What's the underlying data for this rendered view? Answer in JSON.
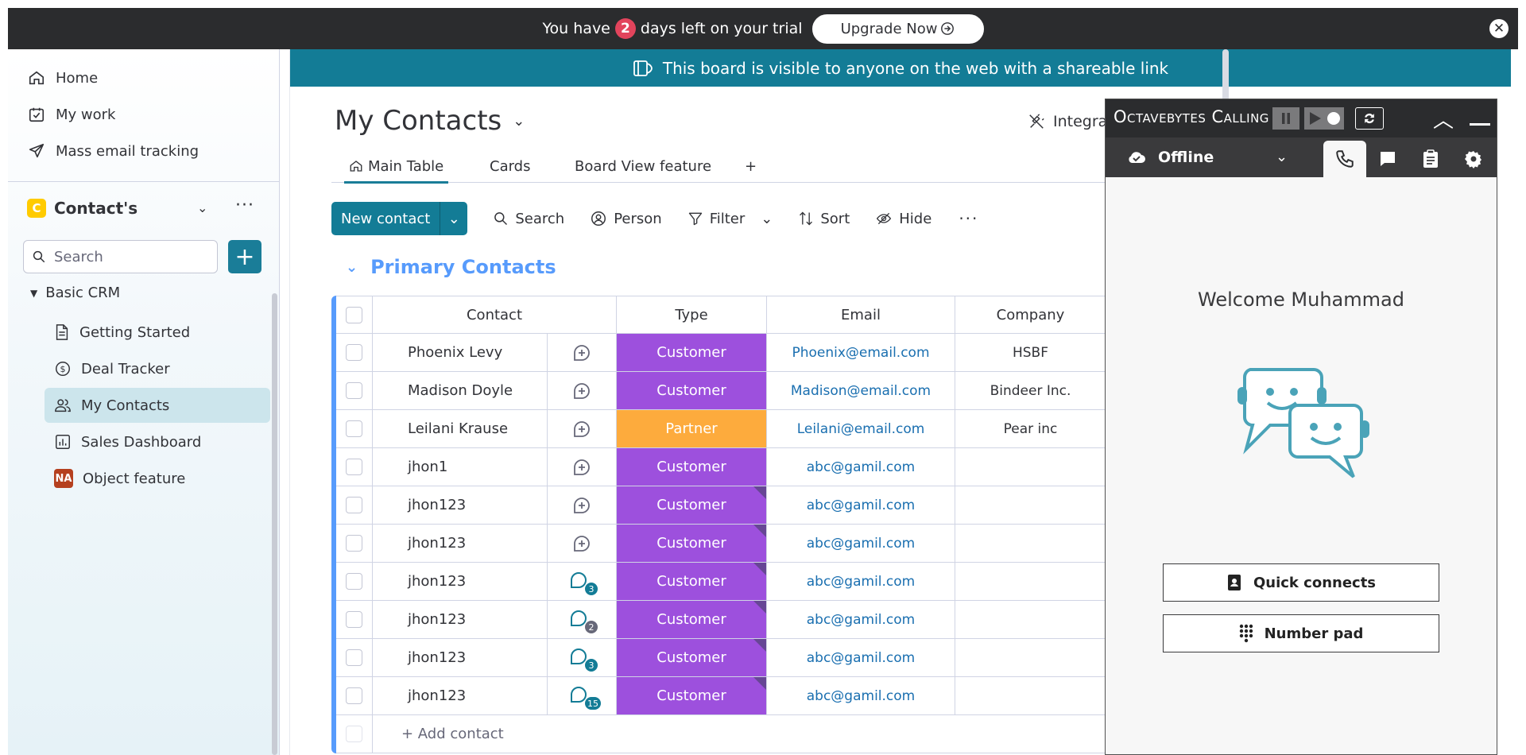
{
  "trial": {
    "prefix": "You have",
    "days": "2",
    "suffix": "days left on your trial",
    "upgrade_label": "Upgrade Now"
  },
  "sidebar": {
    "nav": [
      {
        "label": "Home",
        "icon": "home-icon"
      },
      {
        "label": "My work",
        "icon": "calendar-check-icon"
      },
      {
        "label": "Mass email tracking",
        "icon": "send-icon"
      }
    ],
    "workspace": {
      "badge": "C",
      "name": "Contact's"
    },
    "search_placeholder": "Search",
    "tree_root": "Basic CRM",
    "items": [
      {
        "label": "Getting Started",
        "icon": "document-icon"
      },
      {
        "label": "Deal Tracker",
        "icon": "dollar-icon"
      },
      {
        "label": "My Contacts",
        "icon": "people-icon",
        "active": true
      },
      {
        "label": "Sales Dashboard",
        "icon": "dashboard-icon"
      },
      {
        "label": "Object feature",
        "icon": "na-badge-icon",
        "badge": "NA"
      }
    ]
  },
  "banner": {
    "text": "This board is visible to anyone on the web with a shareable link"
  },
  "board": {
    "title": "My Contacts",
    "integrate": "Integrat",
    "tabs": [
      "Main Table",
      "Cards",
      "Board View feature",
      "+"
    ]
  },
  "toolbar": {
    "new_label": "New contact",
    "search": "Search",
    "person": "Person",
    "filter": "Filter",
    "sort": "Sort",
    "hide": "Hide",
    "more": "···"
  },
  "group": {
    "title": "Primary Contacts"
  },
  "table": {
    "columns": [
      "Contact",
      "Type",
      "Email",
      "Company"
    ],
    "rows": [
      {
        "name": "Phoenix Levy",
        "type": "Customer",
        "email": "Phoenix@email.com",
        "company": "HSBF",
        "updates": ""
      },
      {
        "name": "Madison Doyle",
        "type": "Customer",
        "email": "Madison@email.com",
        "company": "Bindeer Inc.",
        "updates": ""
      },
      {
        "name": "Leilani Krause",
        "type": "Partner",
        "email": "Leilani@email.com",
        "company": "Pear inc",
        "updates": ""
      },
      {
        "name": "jhon1",
        "type": "Customer",
        "email": "abc@gamil.com",
        "company": "",
        "updates": ""
      },
      {
        "name": "jhon123",
        "type": "Customer",
        "email": "abc@gamil.com",
        "company": "",
        "updates": ""
      },
      {
        "name": "jhon123",
        "type": "Customer",
        "email": "abc@gamil.com",
        "company": "",
        "updates": ""
      },
      {
        "name": "jhon123",
        "type": "Customer",
        "email": "abc@gamil.com",
        "company": "",
        "updates": "3"
      },
      {
        "name": "jhon123",
        "type": "Customer",
        "email": "abc@gamil.com",
        "company": "",
        "updates": "2"
      },
      {
        "name": "jhon123",
        "type": "Customer",
        "email": "abc@gamil.com",
        "company": "",
        "updates": "3"
      },
      {
        "name": "jhon123",
        "type": "Customer",
        "email": "abc@gamil.com",
        "company": "",
        "updates": "15"
      }
    ],
    "add_label": "+ Add contact"
  },
  "colors": {
    "customer": "#9d50dd",
    "partner": "#fdab3d",
    "accent": "#137c96",
    "group": "#579bfc"
  },
  "calling": {
    "title": "Octavebytes Calling",
    "status": "Offline",
    "welcome": "Welcome Muhammad",
    "quick_connects": "Quick connects",
    "number_pad": "Number pad"
  }
}
